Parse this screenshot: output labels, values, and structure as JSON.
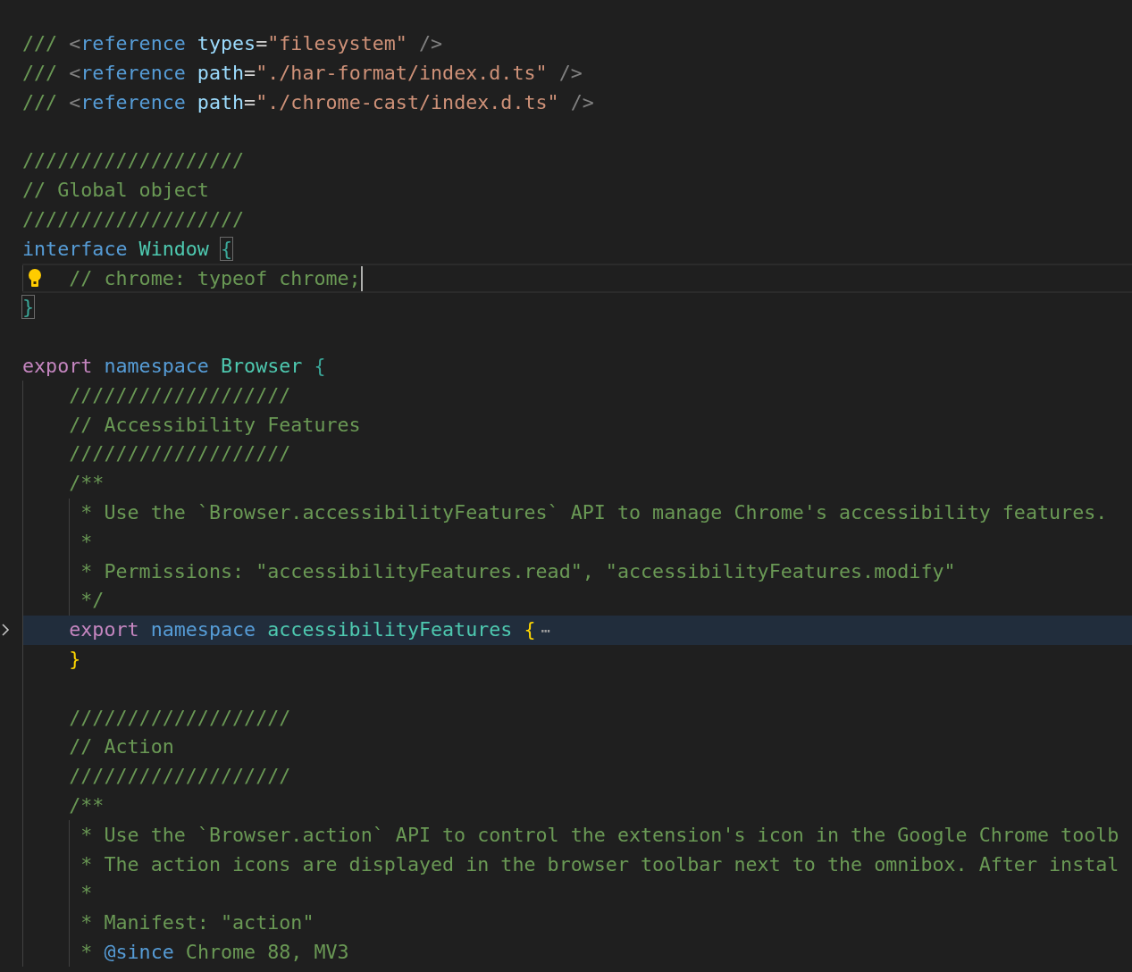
{
  "editor": {
    "lines": [
      {
        "kind": "blank"
      },
      {
        "tokens": [
          {
            "kind": "comment",
            "text": "///"
          },
          {
            "kind": "punct",
            "text": " <"
          },
          {
            "kind": "tag",
            "text": "reference"
          },
          {
            "kind": "attr",
            "text": " types"
          },
          {
            "kind": "plain",
            "text": "="
          },
          {
            "kind": "string",
            "text": "\"filesystem\""
          },
          {
            "kind": "punct",
            "text": " />"
          }
        ]
      },
      {
        "tokens": [
          {
            "kind": "comment",
            "text": "///"
          },
          {
            "kind": "punct",
            "text": " <"
          },
          {
            "kind": "tag",
            "text": "reference"
          },
          {
            "kind": "attr",
            "text": " path"
          },
          {
            "kind": "plain",
            "text": "="
          },
          {
            "kind": "string",
            "text": "\"./har-format/index.d.ts\""
          },
          {
            "kind": "punct",
            "text": " />"
          }
        ]
      },
      {
        "tokens": [
          {
            "kind": "comment",
            "text": "///"
          },
          {
            "kind": "punct",
            "text": " <"
          },
          {
            "kind": "tag",
            "text": "reference"
          },
          {
            "kind": "attr",
            "text": " path"
          },
          {
            "kind": "plain",
            "text": "="
          },
          {
            "kind": "string",
            "text": "\"./chrome-cast/index.d.ts\""
          },
          {
            "kind": "punct",
            "text": " />"
          }
        ]
      },
      {
        "kind": "blank"
      },
      {
        "tokens": [
          {
            "kind": "comment",
            "text": "///////////////////"
          }
        ]
      },
      {
        "tokens": [
          {
            "kind": "comment",
            "text": "// Global object"
          }
        ]
      },
      {
        "tokens": [
          {
            "kind": "comment",
            "text": "///////////////////"
          }
        ]
      },
      {
        "tokens": [
          {
            "kind": "keyword",
            "text": "interface"
          },
          {
            "kind": "type",
            "text": " Window"
          },
          {
            "kind": "bracket",
            "text": " {",
            "matched": true
          }
        ]
      },
      {
        "current": true,
        "lightbulb": true,
        "tokens": [
          {
            "kind": "comment",
            "text": "    // chrome: typeof chrome;"
          }
        ]
      },
      {
        "tokens": [
          {
            "kind": "bracket",
            "text": "}",
            "matched": true
          }
        ]
      },
      {
        "kind": "blank"
      },
      {
        "tokens": [
          {
            "kind": "control",
            "text": "export"
          },
          {
            "kind": "keyword",
            "text": " namespace"
          },
          {
            "kind": "type",
            "text": " Browser"
          },
          {
            "kind": "bracket",
            "text": " {"
          }
        ]
      },
      {
        "tokens": [
          {
            "kind": "comment",
            "text": "    ///////////////////"
          }
        ]
      },
      {
        "tokens": [
          {
            "kind": "comment",
            "text": "    // Accessibility Features"
          }
        ]
      },
      {
        "tokens": [
          {
            "kind": "comment",
            "text": "    ///////////////////"
          }
        ]
      },
      {
        "tokens": [
          {
            "kind": "comment",
            "text": "    /**"
          }
        ]
      },
      {
        "tokens": [
          {
            "kind": "comment",
            "text": "     * Use the `Browser.accessibilityFeatures` API to manage Chrome's accessibility features."
          }
        ]
      },
      {
        "tokens": [
          {
            "kind": "comment",
            "text": "     *"
          }
        ]
      },
      {
        "tokens": [
          {
            "kind": "comment",
            "text": "     * Permissions: \"accessibilityFeatures.read\", \"accessibilityFeatures.modify\""
          }
        ]
      },
      {
        "tokens": [
          {
            "kind": "comment",
            "text": "     */"
          }
        ]
      },
      {
        "folded": true,
        "fold_ellipsis": "⋯",
        "tokens": [
          {
            "kind": "control",
            "text": "    export"
          },
          {
            "kind": "keyword",
            "text": " namespace"
          },
          {
            "kind": "type",
            "text": " accessibilityFeatures"
          },
          {
            "kind": "bracket-gold",
            "text": " {"
          }
        ]
      },
      {
        "tokens": [
          {
            "kind": "bracket-gold",
            "text": "    }"
          }
        ]
      },
      {
        "kind": "blank"
      },
      {
        "tokens": [
          {
            "kind": "comment",
            "text": "    ///////////////////"
          }
        ]
      },
      {
        "tokens": [
          {
            "kind": "comment",
            "text": "    // Action"
          }
        ]
      },
      {
        "tokens": [
          {
            "kind": "comment",
            "text": "    ///////////////////"
          }
        ]
      },
      {
        "tokens": [
          {
            "kind": "comment",
            "text": "    /**"
          }
        ]
      },
      {
        "tokens": [
          {
            "kind": "comment",
            "text": "     * Use the `Browser.action` API to control the extension's icon in the Google Chrome toolb"
          }
        ]
      },
      {
        "tokens": [
          {
            "kind": "comment",
            "text": "     * The action icons are displayed in the browser toolbar next to the omnibox. After instal"
          }
        ]
      },
      {
        "tokens": [
          {
            "kind": "comment",
            "text": "     *"
          }
        ]
      },
      {
        "tokens": [
          {
            "kind": "comment",
            "text": "     * Manifest: \"action\""
          }
        ]
      },
      {
        "tokens": [
          {
            "kind": "comment",
            "text": "     *"
          },
          {
            "kind": "doctag",
            "text": " @since"
          },
          {
            "kind": "docvalue",
            "text": " Chrome 88, MV3"
          }
        ]
      }
    ]
  }
}
